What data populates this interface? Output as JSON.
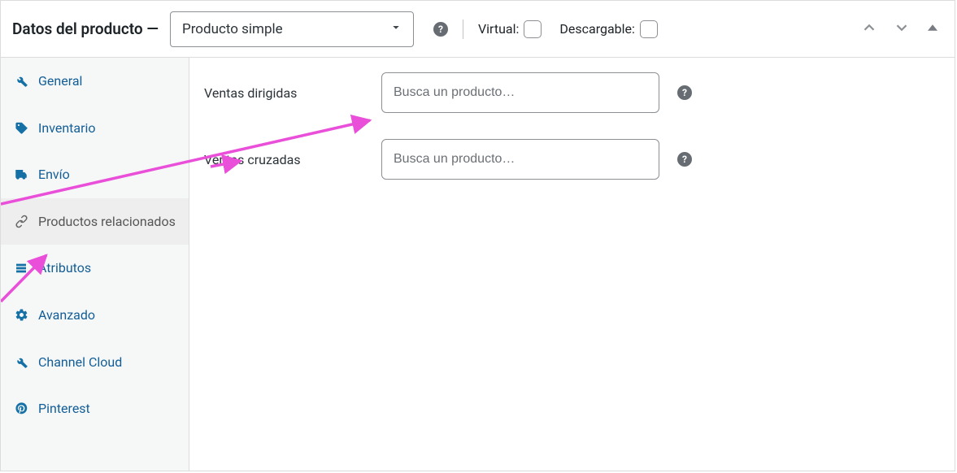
{
  "header": {
    "title": "Datos del producto —",
    "product_type": "Producto simple",
    "virtual_label": "Virtual:",
    "downloadable_label": "Descargable:"
  },
  "sidebar": {
    "items": [
      {
        "label": "General"
      },
      {
        "label": "Inventario"
      },
      {
        "label": "Envío"
      },
      {
        "label": "Productos relacionados"
      },
      {
        "label": "Atributos"
      },
      {
        "label": "Avanzado"
      },
      {
        "label": "Channel Cloud"
      },
      {
        "label": "Pinterest"
      }
    ]
  },
  "fields": {
    "upsells": {
      "label": "Ventas dirigidas",
      "placeholder": "Busca un producto…"
    },
    "cross_sells": {
      "label": "Ventas cruzadas",
      "placeholder": "Busca un producto…"
    }
  },
  "colors": {
    "link": "#135e96",
    "icon_blue": "#1570a6",
    "annotation": "#e94fd8"
  }
}
